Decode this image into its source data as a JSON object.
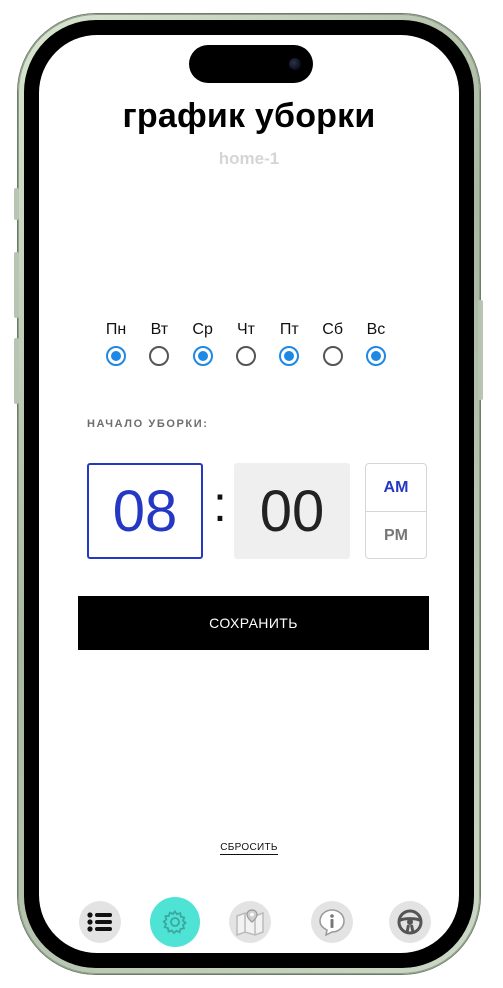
{
  "header": {
    "title": "график уборки",
    "subtitle": "home-1"
  },
  "days": [
    {
      "label": "Пн",
      "selected": true
    },
    {
      "label": "Вт",
      "selected": false
    },
    {
      "label": "Ср",
      "selected": true
    },
    {
      "label": "Чт",
      "selected": false
    },
    {
      "label": "Пт",
      "selected": true
    },
    {
      "label": "Сб",
      "selected": false
    },
    {
      "label": "Вс",
      "selected": true
    }
  ],
  "start": {
    "label": "НАЧАЛО УБОРКИ:",
    "hour": "08",
    "separator": ":",
    "minute": "00",
    "am_label": "AM",
    "pm_label": "PM",
    "period_selected": "AM"
  },
  "actions": {
    "save_label": "СОХРАНИТЬ",
    "reset_label": "СБРОСИТЬ"
  },
  "tabs": [
    {
      "icon": "list-icon",
      "active": false
    },
    {
      "icon": "gear-icon",
      "active": true
    },
    {
      "icon": "map-icon",
      "active": false
    },
    {
      "icon": "info-icon",
      "active": false
    },
    {
      "icon": "steering-wheel-icon",
      "active": false
    }
  ],
  "colors": {
    "accent": "#2438c4",
    "radio_on": "#1e88e5",
    "active_tab": "#4fe3d6",
    "subtitle": "#d5d5d5"
  }
}
